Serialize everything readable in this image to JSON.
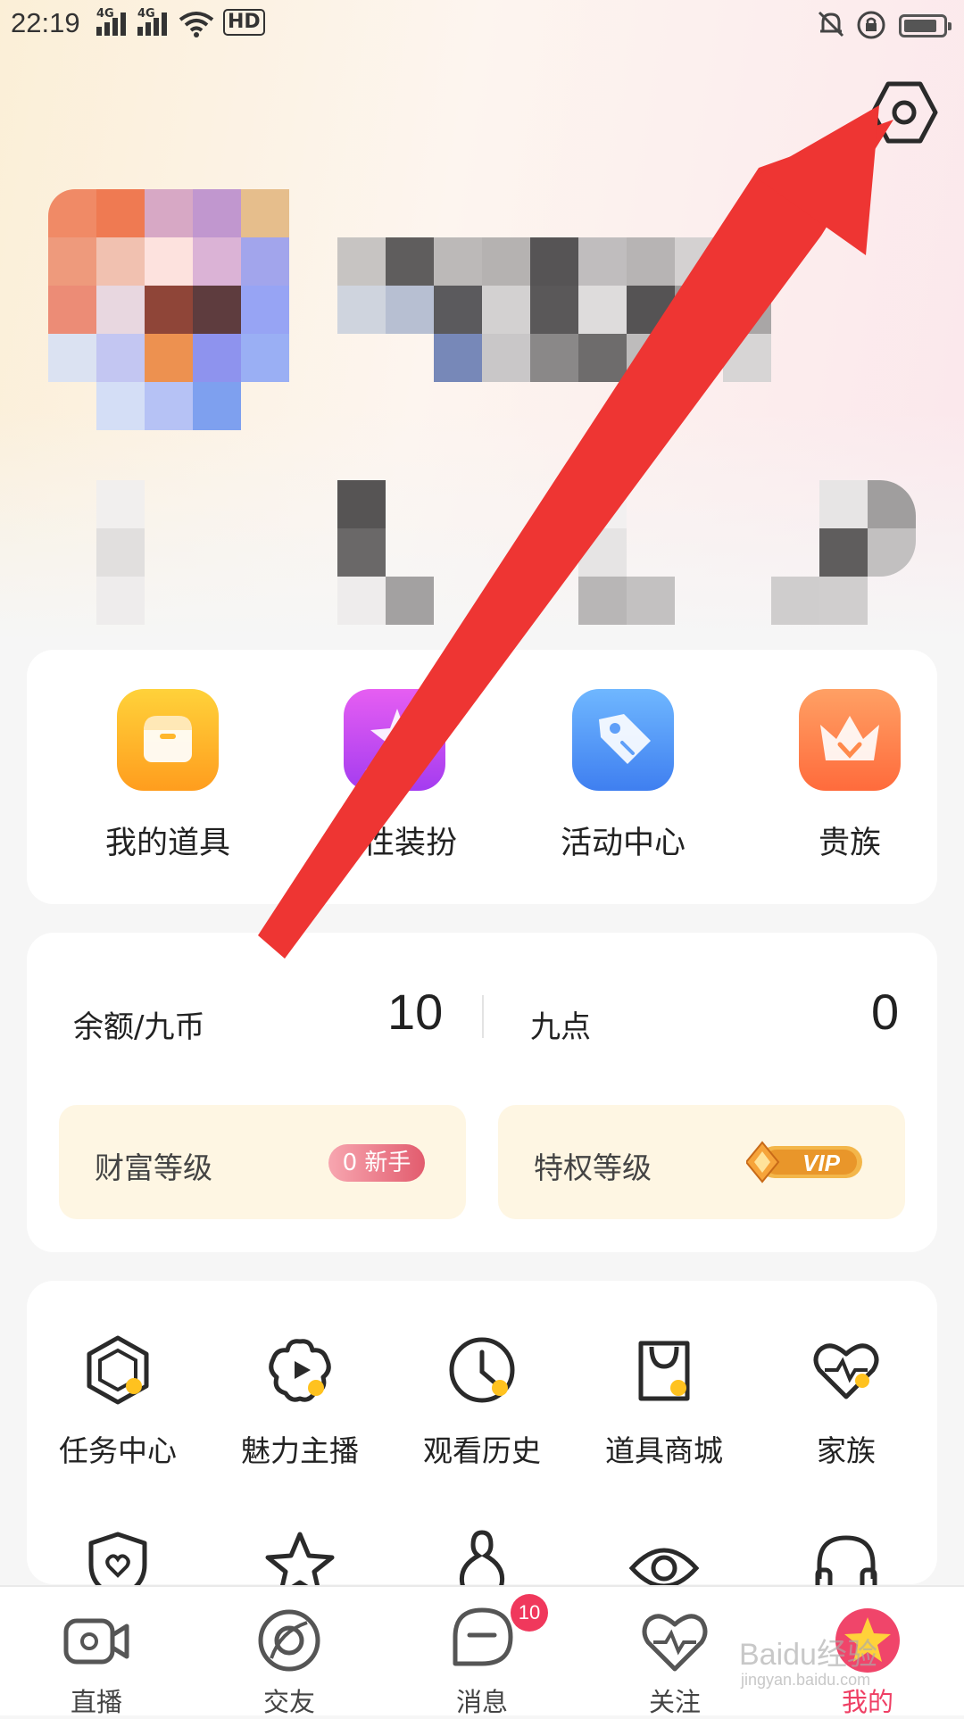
{
  "status_bar": {
    "time": "22:19",
    "network1": "4G",
    "network2": "4G",
    "hd": "HD"
  },
  "quick_actions": [
    {
      "label": "我的道具",
      "icon": "props-box-icon",
      "color": "#ffb420"
    },
    {
      "label": "个性装扮",
      "icon": "magic-wand-icon",
      "color": "#c050f0"
    },
    {
      "label": "活动中心",
      "icon": "tag-icon",
      "color": "#3f8ff5"
    },
    {
      "label": "贵族",
      "icon": "crown-icon",
      "color": "#ff6b3c"
    }
  ],
  "balance": {
    "coin_label": "余额/九币",
    "coin_value": "10",
    "points_label": "九点",
    "points_value": "0"
  },
  "levels": {
    "wealth_label": "财富等级",
    "wealth_badge": "0 新手",
    "privilege_label": "特权等级",
    "privilege_badge": "VIP"
  },
  "features": [
    {
      "label": "任务中心",
      "icon": "task-hexagon-icon"
    },
    {
      "label": "魅力主播",
      "icon": "charm-anchor-icon"
    },
    {
      "label": "观看历史",
      "icon": "clock-icon"
    },
    {
      "label": "道具商城",
      "icon": "shopping-bag-icon"
    },
    {
      "label": "家族",
      "icon": "heart-pulse-icon"
    }
  ],
  "tabs": [
    {
      "label": "直播",
      "icon": "camera-icon"
    },
    {
      "label": "交友",
      "icon": "planet-icon"
    },
    {
      "label": "消息",
      "icon": "message-icon",
      "badge": "10"
    },
    {
      "label": "关注",
      "icon": "heart-pulse-icon"
    },
    {
      "label": "我的",
      "icon": "star-icon",
      "active": true
    }
  ],
  "watermark": {
    "text": "Baidu经验",
    "sub": "jingyan.baidu.com"
  },
  "colors": {
    "accent": "#ef3f64",
    "arrow": "#ee3533",
    "icon_dot": "#ffc21f"
  }
}
